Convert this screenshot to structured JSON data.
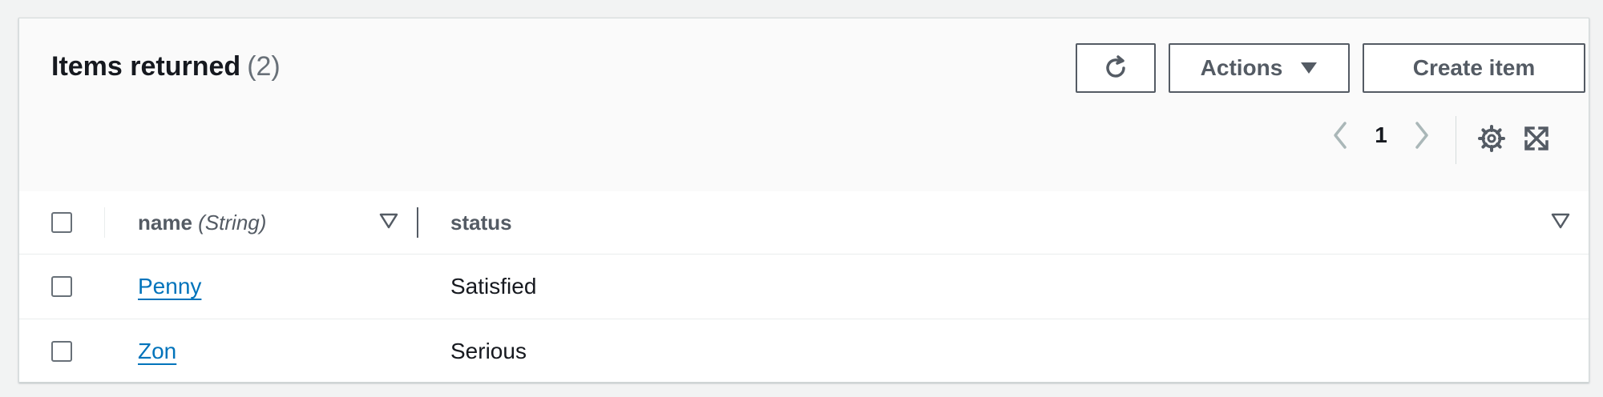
{
  "table": {
    "title": "Items returned",
    "count": "(2)",
    "toolbar": {
      "refresh_icon": "refresh-icon",
      "actions_label": "Actions",
      "actions_icon": "caret-down-icon",
      "create_label": "Create item"
    },
    "pagination": {
      "current_page": "1",
      "prev_icon": "chevron-left-icon",
      "next_icon": "chevron-right-icon"
    },
    "tools": [
      "settings-gear-icon",
      "fullscreen-expand-icon"
    ],
    "columns": [
      {
        "name": "name",
        "type": "(String)"
      },
      {
        "name": "status"
      }
    ],
    "rows": [
      {
        "name": "Penny",
        "status": "Satisfied"
      },
      {
        "name": "Zon",
        "status": "Serious"
      }
    ]
  },
  "colors": {
    "link": "#0073bb",
    "border": "#545b64",
    "text": "#16191f",
    "muted": "#687078",
    "header_bg": "#fafafa"
  }
}
